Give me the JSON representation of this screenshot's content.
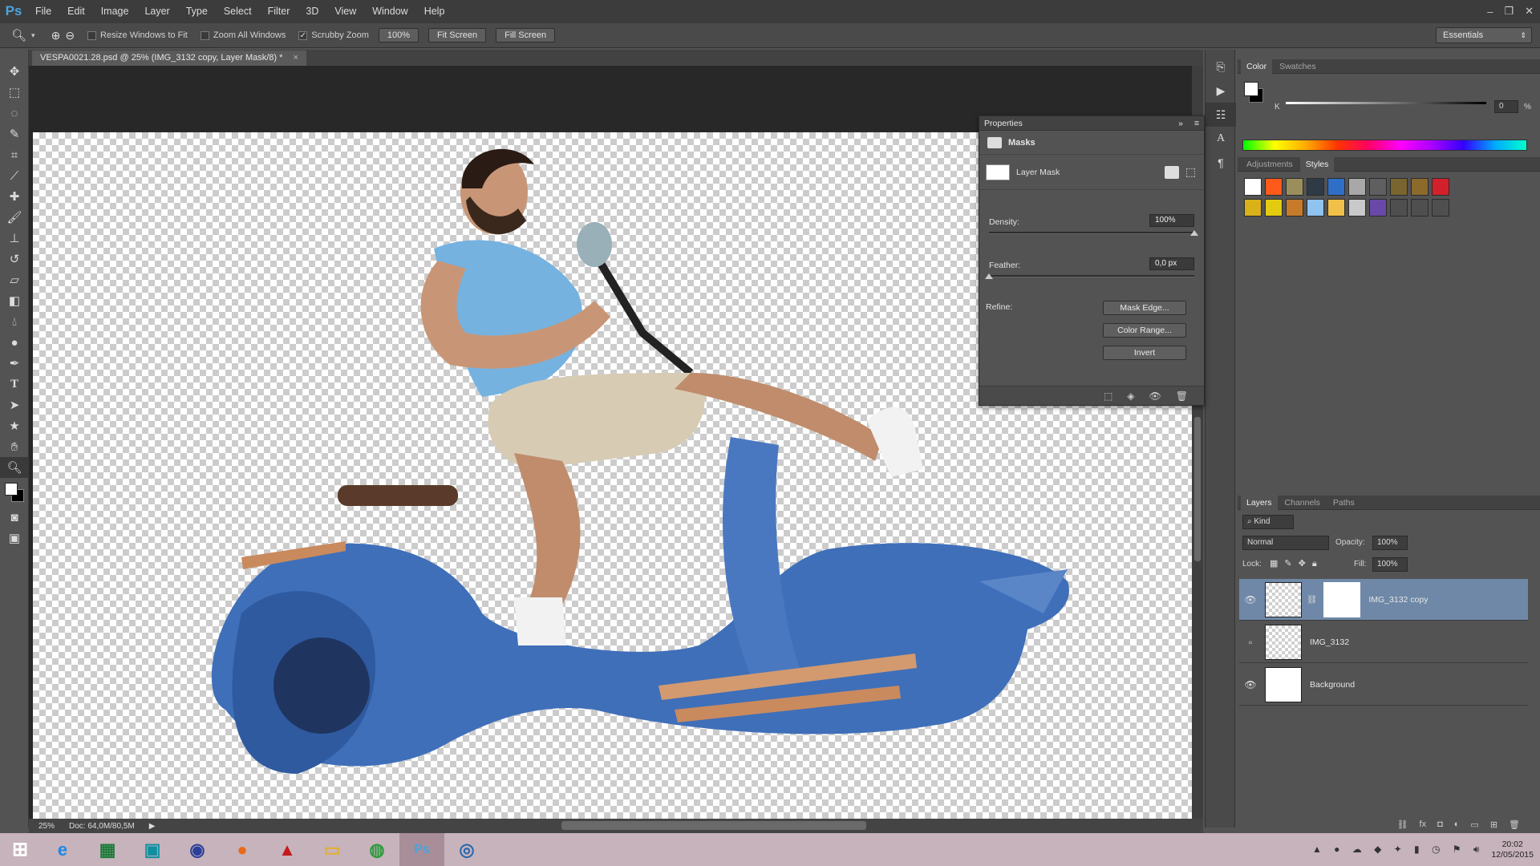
{
  "app": {
    "logo": "Ps",
    "menu": [
      "File",
      "Edit",
      "Image",
      "Layer",
      "Type",
      "Select",
      "Filter",
      "3D",
      "View",
      "Window",
      "Help"
    ],
    "window_controls": [
      "–",
      "❐",
      "✕"
    ]
  },
  "options": {
    "resize_windows": "Resize Windows to Fit",
    "zoom_all": "Zoom All Windows",
    "scrubby_zoom": "Scrubby Zoom",
    "zoom_value": "100%",
    "fit_screen": "Fit Screen",
    "fill_screen": "Fill Screen",
    "workspace": "Essentials"
  },
  "document": {
    "tab_title": "VESPA0021.28.psd @ 25% (IMG_3132 copy, Layer Mask/8) *",
    "tab_close": "×",
    "zoom": "25%",
    "doc_size": "Doc: 64,0M/80,5M"
  },
  "properties": {
    "title": "Properties",
    "section": "Masks",
    "mask_label": "Layer Mask",
    "density_label": "Density:",
    "density_value": "100%",
    "density": 1.0,
    "feather_label": "Feather:",
    "feather_value": "0,0 px",
    "feather": 0.0,
    "refine_label": "Refine:",
    "mask_edge": "Mask Edge...",
    "color_range": "Color Range...",
    "invert": "Invert"
  },
  "color_panel": {
    "tabs": [
      "Color",
      "Swatches"
    ],
    "k_label": "K",
    "k_value": "0",
    "k_unit": "%"
  },
  "styles_panel": {
    "tabs": [
      "Adjustments",
      "Styles"
    ],
    "swatches": [
      "#ffffff",
      "#ff5a1a",
      "#9a8f5c",
      "#2e3a46",
      "#2f6fc7",
      "#a8a8a8",
      "#5f5f5f",
      "#7a6530",
      "#8c6a2c",
      "#d4202a",
      "#d9b21a",
      "#e3cc10",
      "#c77a2a",
      "#8fc3f0",
      "#f0c048",
      "#c9c9c9",
      "#6a48a8",
      "#4f4f4f",
      "#4f4f4f",
      "#4f4f4f"
    ]
  },
  "layers_panel": {
    "tabs": [
      "Layers",
      "Channels",
      "Paths"
    ],
    "kind": "Kind",
    "blend_mode": "Normal",
    "opacity_label": "Opacity:",
    "opacity_value": "100%",
    "lock_label": "Lock:",
    "fill_label": "Fill:",
    "fill_value": "100%",
    "layers": [
      {
        "name": "IMG_3132 copy",
        "visible": true,
        "selected": true
      },
      {
        "name": "IMG_3132",
        "visible": false,
        "selected": false
      },
      {
        "name": "Background",
        "visible": true,
        "selected": false
      }
    ]
  },
  "taskbar": {
    "time": "20:02",
    "date": "12/05/2015"
  }
}
